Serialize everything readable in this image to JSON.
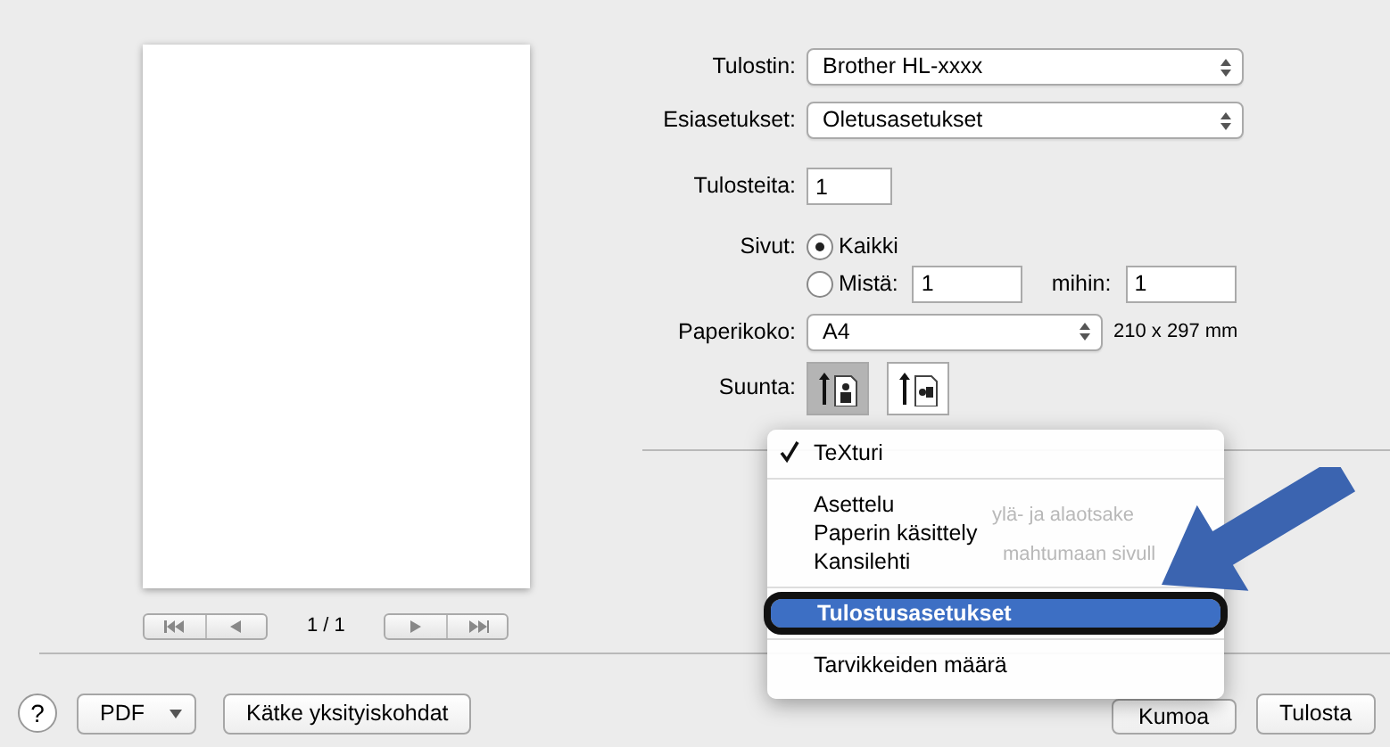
{
  "printer": {
    "label": "Tulostin:",
    "value": "Brother HL-xxxx"
  },
  "presets": {
    "label": "Esiasetukset:",
    "value": "Oletusasetukset"
  },
  "copies": {
    "label": "Tulosteita:",
    "value": "1"
  },
  "pages": {
    "label": "Sivut:",
    "options": [
      {
        "label": "Kaikki",
        "selected": true
      },
      {
        "label": "Mistä:",
        "selected": false
      }
    ],
    "from": "1",
    "to_label": "mihin:",
    "to": "1"
  },
  "paper_size": {
    "label": "Paperikoko:",
    "value": "A4",
    "dimensions": "210 x 297 mm"
  },
  "orientation": {
    "label": "Suunta:",
    "options": [
      {
        "kind": "portrait",
        "selected": true
      },
      {
        "kind": "landscape",
        "selected": false
      }
    ]
  },
  "preview": {
    "page_counter": "1 / 1"
  },
  "ghost_texts": [
    "ylä- ja alaotsake",
    "mahtumaan sivull"
  ],
  "section_menu": {
    "groups": [
      [
        {
          "label": "TeXturi",
          "checked": true,
          "selected": false,
          "circled": false
        }
      ],
      [
        {
          "label": "Asettelu",
          "checked": false,
          "selected": false,
          "circled": false
        },
        {
          "label": "Paperin käsittely",
          "checked": false,
          "selected": false,
          "circled": false
        },
        {
          "label": "Kansilehti",
          "checked": false,
          "selected": false,
          "circled": false
        }
      ],
      [
        {
          "label": "Tulostusasetukset",
          "checked": false,
          "selected": true,
          "circled": true
        }
      ],
      [
        {
          "label": "Tarvikkeiden määrä",
          "checked": false,
          "selected": false,
          "circled": false
        }
      ]
    ]
  },
  "footer": {
    "help": "?",
    "pdf": "PDF",
    "details": "Kätke yksityiskohdat",
    "cancel": "Kumoa",
    "print": "Tulosta"
  }
}
